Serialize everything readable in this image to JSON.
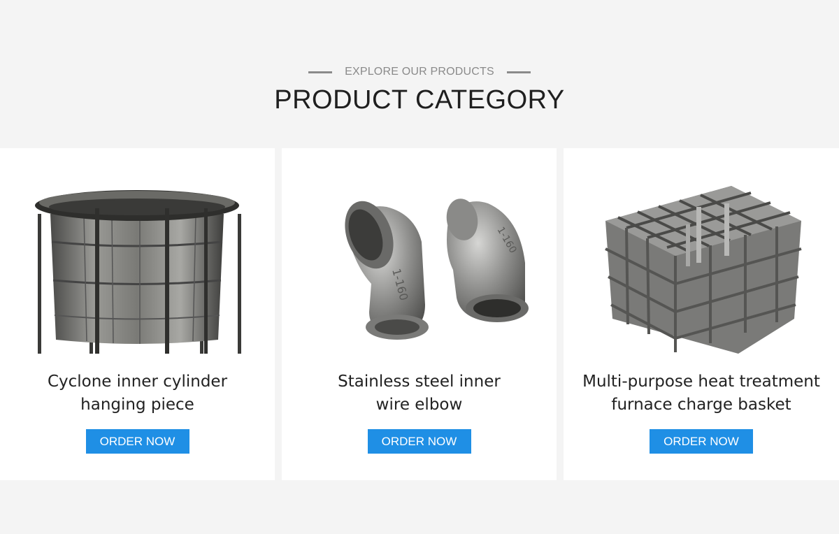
{
  "section": {
    "eyebrow": "EXPLORE OUR PRODUCTS",
    "title": "PRODUCT CATEGORY"
  },
  "products": [
    {
      "name_line1": "Cyclone inner cylinder",
      "name_line2": "hanging piece",
      "button_label": "ORDER NOW",
      "image_icon": "cyclone-cylinder-photo"
    },
    {
      "name_line1": "Stainless steel inner",
      "name_line2": "wire elbow",
      "button_label": "ORDER NOW",
      "image_icon": "pipe-elbow-photo"
    },
    {
      "name_line1": "Multi-purpose heat treatment",
      "name_line2": "furnace charge basket",
      "button_label": "ORDER NOW",
      "image_icon": "charge-basket-photo"
    }
  ],
  "colors": {
    "background": "#f4f4f4",
    "card": "#ffffff",
    "accent": "#1f8fe5",
    "title": "#1f1f1f",
    "eyebrow": "#8a8a8a"
  }
}
